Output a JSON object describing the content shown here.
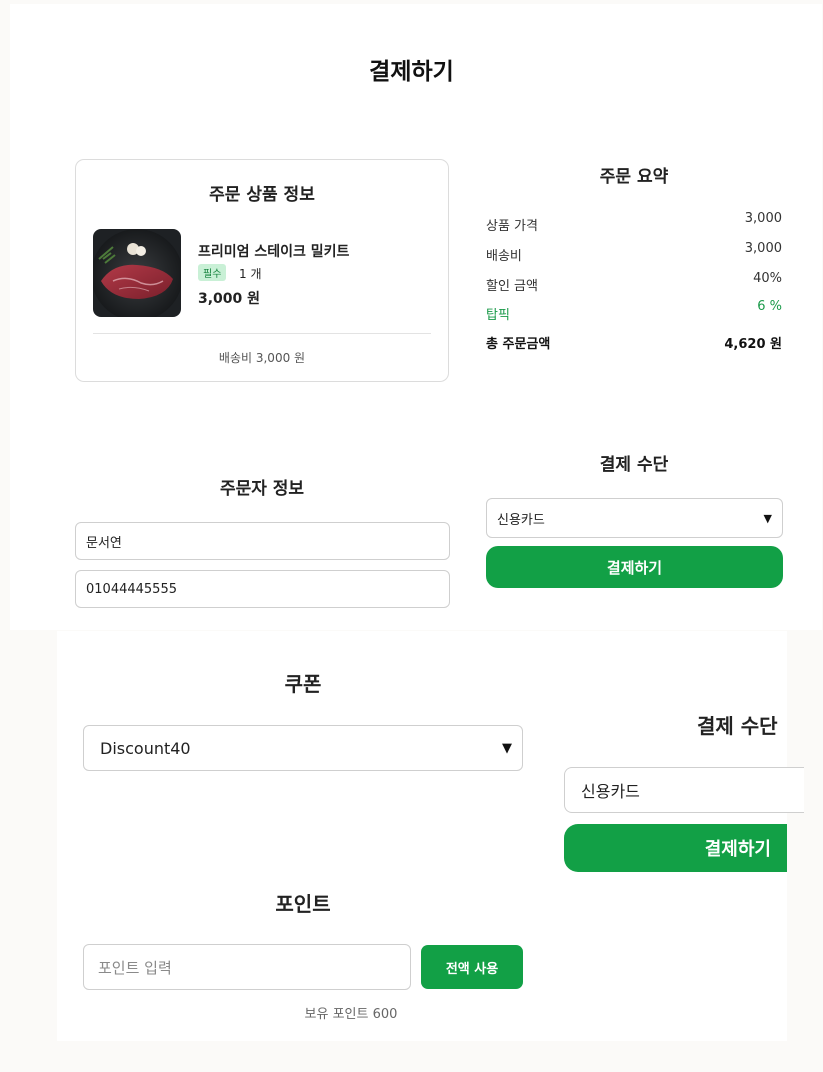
{
  "page_title": "결제하기",
  "order_card": {
    "title": "주문 상품 정보",
    "product_name": "프리미엄 스테이크 밀키트",
    "badge": "필수",
    "quantity": "1 개",
    "price": "3,000 원",
    "shipping_note": "배송비 3,000 원"
  },
  "summary": {
    "title": "주문 요약",
    "rows": [
      {
        "label": "상품 가격",
        "value": "3,000"
      },
      {
        "label": "배송비",
        "value": "3,000"
      },
      {
        "label": "할인 금액",
        "value": "40%"
      },
      {
        "label": "탑픽",
        "value": "6 %"
      },
      {
        "label": "총 주문금액",
        "value": "4,620 원"
      }
    ]
  },
  "buyer": {
    "title": "주문자 정보",
    "name_value": "문서연",
    "phone_value": "01044445555"
  },
  "payment_top": {
    "title": "결제 수단",
    "selected": "신용카드",
    "button": "결제하기"
  },
  "coupon": {
    "title": "쿠폰",
    "selected": "Discount40"
  },
  "payment_bottom": {
    "title": "결제 수단",
    "selected": "신용카드",
    "button": "결제하기"
  },
  "points": {
    "title": "포인트",
    "placeholder": "포인트 입력",
    "use_all_button": "전액 사용",
    "balance": "보유 포인트 600"
  },
  "colors": {
    "accent": "#12a046",
    "badge_bg": "#c9f0d6",
    "highlight_text": "#1b9a4a"
  }
}
